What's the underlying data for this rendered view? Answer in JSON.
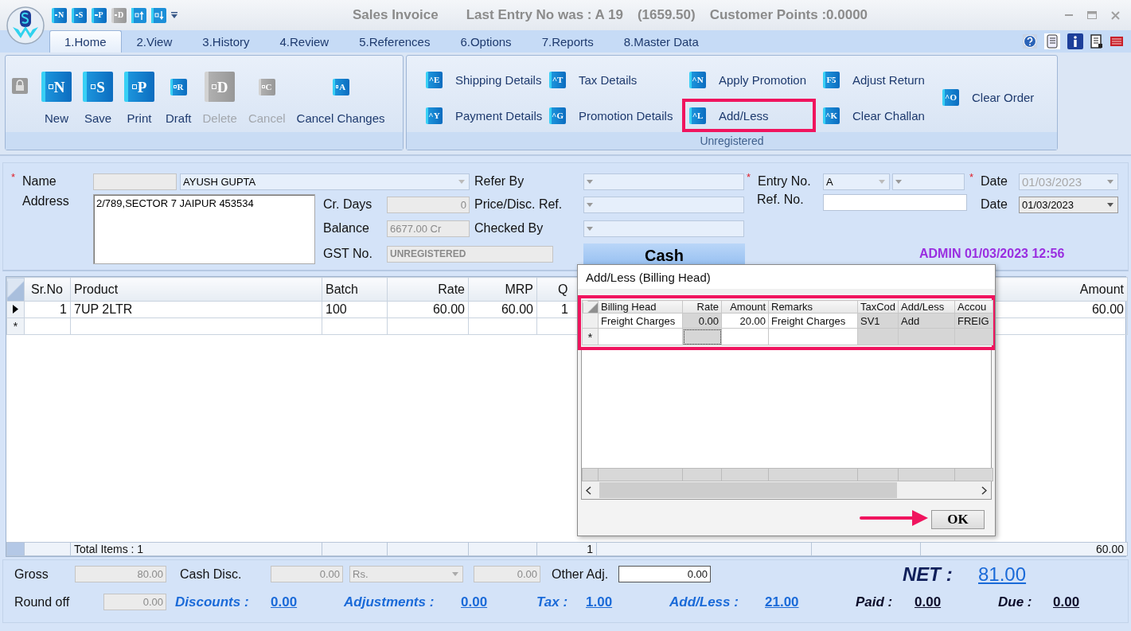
{
  "title_bar": {
    "quick_access": [
      {
        "kind": "letter",
        "letter": "N",
        "disabled": false
      },
      {
        "kind": "letter",
        "letter": "S",
        "disabled": false
      },
      {
        "kind": "letter",
        "letter": "P",
        "disabled": false
      },
      {
        "kind": "letter",
        "letter": "D",
        "disabled": true
      },
      {
        "kind": "arrow_up",
        "disabled": false
      },
      {
        "kind": "arrow_down",
        "disabled": false
      }
    ],
    "title": "Sales Invoice",
    "last_entry": "Last Entry No was : A 19",
    "last_amount": "(1659.50)",
    "customer_points": "Customer Points :0.0000"
  },
  "tabs": [
    {
      "label": "1.Home",
      "selected": true
    },
    {
      "label": "2.View",
      "selected": false
    },
    {
      "label": "3.History",
      "selected": false
    },
    {
      "label": "4.Review",
      "selected": false
    },
    {
      "label": "5.References",
      "selected": false
    },
    {
      "label": "6.Options",
      "selected": false
    },
    {
      "label": "7.Reports",
      "selected": false
    },
    {
      "label": "8.Master Data",
      "selected": false
    }
  ],
  "ribbon": {
    "home_group": {
      "buttons": [
        {
          "label": "New",
          "icon_letter": "N",
          "kind": "large",
          "disabled": false
        },
        {
          "label": "Save",
          "icon_letter": "S",
          "kind": "large",
          "disabled": false
        },
        {
          "label": "Print",
          "icon_letter": "P",
          "kind": "large",
          "disabled": false
        },
        {
          "label": "Draft",
          "icon_letter": "R",
          "kind": "small",
          "disabled": false
        },
        {
          "label": "Delete",
          "icon_letter": "D",
          "kind": "large",
          "disabled": true
        },
        {
          "label": "Cancel",
          "icon_letter": "C",
          "kind": "small",
          "disabled": true
        },
        {
          "label": "Cancel Changes",
          "icon_letter": "A",
          "kind": "small",
          "disabled": false
        }
      ]
    },
    "actions_group": {
      "caption": "Unregistered",
      "columns": [
        [
          {
            "label": "Shipping Details",
            "shortcut": "^E",
            "highlighted": false
          },
          {
            "label": "Payment Details",
            "shortcut": "^Y",
            "highlighted": false
          }
        ],
        [
          {
            "label": "Tax Details",
            "shortcut": "^T",
            "highlighted": false
          },
          {
            "label": "Promotion Details",
            "shortcut": "^G",
            "highlighted": false
          }
        ],
        [
          {
            "label": "Apply Promotion",
            "shortcut": "^N",
            "highlighted": false
          },
          {
            "label": "Add/Less",
            "shortcut": "^L",
            "highlighted": true
          }
        ],
        [
          {
            "label": "Adjust Return",
            "shortcut": "F5",
            "highlighted": false
          },
          {
            "label": "Clear Challan",
            "shortcut": "^K",
            "highlighted": false
          }
        ],
        [
          {
            "label": "Clear Order",
            "shortcut": "^O",
            "highlighted": false
          }
        ]
      ]
    }
  },
  "form": {
    "name_required_mark": "*",
    "name_label": "Name",
    "customer_name": "AYUSH GUPTA",
    "address_label": "Address",
    "address": "2/789,SECTOR 7 JAIPUR 453534",
    "cr_days_label": "Cr. Days",
    "cr_days": "0",
    "balance_label": "Balance",
    "balance": "6677.00 Cr",
    "gst_label": "GST No.",
    "gst": "UNREGISTERED",
    "refer_by_label": "Refer By",
    "price_ref_label": "Price/Disc. Ref.",
    "checked_by_label": "Checked By",
    "payment_mode": "Cash",
    "entry_required_mark": "*",
    "entry_label": "Entry No.",
    "entry_series": "A",
    "ref_label": "Ref. No.",
    "date_required_mark": "*",
    "date_label": "Date",
    "date": "01/03/2023",
    "date_disabled": true,
    "ref_date_label": "Date",
    "ref_date": "01/03/2023",
    "created_by": "ADMIN 01/03/2023 12:56"
  },
  "grid": {
    "columns": [
      {
        "label": "Sr.No"
      },
      {
        "label": "Product"
      },
      {
        "label": "Batch"
      },
      {
        "label": "Rate"
      },
      {
        "label": "MRP"
      },
      {
        "label": "Q"
      },
      {
        "label": "Amount"
      }
    ],
    "rows": [
      {
        "current": true,
        "cells": [
          "1",
          "7UP 2LTR",
          "100",
          "60.00",
          "60.00",
          "1",
          "60.00"
        ]
      }
    ],
    "new_row_mark": "*",
    "totals": {
      "items": "Total Items : 1",
      "quantity": "1",
      "amount": "60.00"
    }
  },
  "footer": {
    "gross_label": "Gross",
    "gross": "80.00",
    "cash_disc_label": "Cash Disc.",
    "cash_disc": "0.00",
    "disc_unit": "Rs.",
    "disc_unit_disabled": true,
    "cash_disc_amount": "0.00",
    "other_adj_label": "Other Adj.",
    "other_adj": "0.00",
    "net_label": "NET :",
    "net": "81.00",
    "round_off_label": "Round off",
    "round_off": "0.00",
    "summary": [
      {
        "label": "Discounts :",
        "value": "0.00",
        "kind": "accent"
      },
      {
        "label": "Adjustments :",
        "value": "0.00",
        "kind": "accent"
      },
      {
        "label": "Tax :",
        "value": "1.00",
        "kind": "accent"
      },
      {
        "label": "Add/Less :",
        "value": "21.00",
        "kind": "accent"
      },
      {
        "label": "Paid :",
        "value": "0.00",
        "kind": "plain"
      },
      {
        "label": "Due :",
        "value": "0.00",
        "kind": "plain"
      }
    ]
  },
  "dialog": {
    "title": "Add/Less (Billing Head)",
    "highlighted": true,
    "columns": [
      {
        "label": "Billing Head",
        "numeric": false,
        "readonly": false
      },
      {
        "label": "Rate",
        "numeric": true,
        "readonly": true
      },
      {
        "label": "Amount",
        "numeric": true,
        "readonly": false
      },
      {
        "label": "Remarks",
        "numeric": false,
        "readonly": false
      },
      {
        "label": "TaxCod",
        "numeric": false,
        "readonly": true
      },
      {
        "label": "Add/Less",
        "numeric": false,
        "readonly": true
      },
      {
        "label": "Accou",
        "numeric": false,
        "readonly": true
      }
    ],
    "rows": [
      {
        "cells": [
          "Freight Charges",
          "0.00",
          "20.00",
          "Freight Charges",
          "SV1",
          "Add",
          "FREIG"
        ]
      }
    ],
    "new_row": {
      "mark": "*",
      "focused": [
        false,
        true,
        false,
        false,
        false,
        false,
        false
      ]
    },
    "ok_label": "OK",
    "ok_pointed": true
  }
}
